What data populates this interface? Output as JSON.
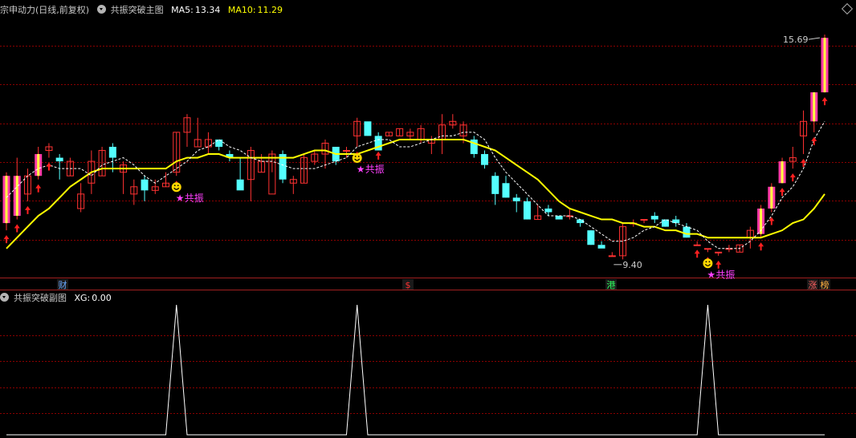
{
  "main_panel": {
    "stock_name": "宗申动力",
    "period_label": "(日线,前复权)",
    "indicator_name": "共振突破主图",
    "ma5_label": "MA5:",
    "ma5_value": "13.34",
    "ma10_label": "MA10:",
    "ma10_value": "11.29",
    "high_label": "15.69",
    "low_label": "9.40",
    "signal_text": "共振",
    "event_markers": [
      "财",
      "$",
      "港",
      "涨",
      "榜"
    ]
  },
  "sub_panel": {
    "indicator_name": "共振突破副图",
    "xg_label": "XG:",
    "xg_value": "0.00"
  },
  "colors": {
    "up": "#ff3232",
    "down": "#54ffff",
    "ma5": "#ffffff",
    "ma10": "#ffff00",
    "grid": "#8b0000",
    "signal": "#ff40ff",
    "arrow": "#ff2020",
    "smiley": "#ffd700"
  },
  "chart_data": [
    {
      "type": "candlestick",
      "title": "",
      "ylim": [
        9.0,
        16.2
      ],
      "candles": [
        [
          10.5,
          11.8,
          10.3,
          11.9
        ],
        [
          10.7,
          11.8,
          10.6,
          12.3
        ],
        [
          11.3,
          11.8,
          11.1,
          12.0
        ],
        [
          11.8,
          12.4,
          11.7,
          12.6
        ],
        [
          12.5,
          12.6,
          12.3,
          12.7
        ],
        [
          12.3,
          12.2,
          11.7,
          12.4
        ],
        [
          11.8,
          12.2,
          11.8,
          12.3
        ],
        [
          10.9,
          11.3,
          10.8,
          11.6
        ],
        [
          11.6,
          12.2,
          11.3,
          12.5
        ],
        [
          11.8,
          12.5,
          11.8,
          12.6
        ],
        [
          12.6,
          12.3,
          11.9,
          12.7
        ],
        [
          11.9,
          12.1,
          11.3,
          12.2
        ],
        [
          11.3,
          11.5,
          11.0,
          11.7
        ],
        [
          11.7,
          11.4,
          11.1,
          11.8
        ],
        [
          11.4,
          11.5,
          11.3,
          11.7
        ],
        [
          11.5,
          11.6,
          11.5,
          11.9
        ],
        [
          11.9,
          13.0,
          11.8,
          13.0
        ],
        [
          13.0,
          13.4,
          12.6,
          13.5
        ],
        [
          12.6,
          12.8,
          12.6,
          13.4
        ],
        [
          12.6,
          12.8,
          12.4,
          13.0
        ],
        [
          12.8,
          12.6,
          12.5,
          12.8
        ],
        [
          12.4,
          12.3,
          12.2,
          12.5
        ],
        [
          11.7,
          11.4,
          11.7,
          12.3
        ],
        [
          11.7,
          12.5,
          11.1,
          12.6
        ],
        [
          11.9,
          12.2,
          11.9,
          12.4
        ],
        [
          11.3,
          12.4,
          11.9,
          12.5
        ],
        [
          12.4,
          11.7,
          11.6,
          12.5
        ],
        [
          11.6,
          11.7,
          11.3,
          11.8
        ],
        [
          11.6,
          12.3,
          11.6,
          12.4
        ],
        [
          12.2,
          12.4,
          12.1,
          12.5
        ],
        [
          12.4,
          12.7,
          12.0,
          12.8
        ],
        [
          12.6,
          12.2,
          12.1,
          12.6
        ],
        [
          12.5,
          12.5,
          12.3,
          12.6
        ],
        [
          12.9,
          13.3,
          12.6,
          13.4
        ],
        [
          13.3,
          12.9,
          12.9,
          13.2
        ],
        [
          12.9,
          12.5,
          12.6,
          13.0
        ],
        [
          12.9,
          13.0,
          12.9,
          13.0
        ],
        [
          12.9,
          13.1,
          12.9,
          13.1
        ],
        [
          12.9,
          13.0,
          12.8,
          13.1
        ],
        [
          12.8,
          13.1,
          12.7,
          13.2
        ],
        [
          12.7,
          12.8,
          12.4,
          12.9
        ],
        [
          12.8,
          13.2,
          12.4,
          13.5
        ],
        [
          13.2,
          13.3,
          13.1,
          13.5
        ],
        [
          12.9,
          13.2,
          12.7,
          13.3
        ],
        [
          12.8,
          12.4,
          12.3,
          12.9
        ],
        [
          12.4,
          12.1,
          12.0,
          12.5
        ],
        [
          11.8,
          11.3,
          11.0,
          11.9
        ],
        [
          11.6,
          11.2,
          11.2,
          11.8
        ],
        [
          11.2,
          11.1,
          10.8,
          11.3
        ],
        [
          11.1,
          10.6,
          10.6,
          11.2
        ],
        [
          10.6,
          10.7,
          10.6,
          11.0
        ],
        [
          10.9,
          10.8,
          10.7,
          11.0
        ],
        [
          10.7,
          10.6,
          10.7,
          10.7
        ],
        [
          10.7,
          10.7,
          10.6,
          10.9
        ],
        [
          10.6,
          10.5,
          10.4,
          10.6
        ],
        [
          10.3,
          9.9,
          9.9,
          10.3
        ],
        [
          9.9,
          9.8,
          9.9,
          10.0
        ],
        [
          9.6,
          9.6,
          9.6,
          9.7
        ],
        [
          9.6,
          10.4,
          9.5,
          10.5
        ],
        [
          10.5,
          10.5,
          10.4,
          10.6
        ],
        [
          10.6,
          10.6,
          10.5,
          10.6
        ],
        [
          10.7,
          10.6,
          10.5,
          10.8
        ],
        [
          10.6,
          10.4,
          10.4,
          10.6
        ],
        [
          10.6,
          10.5,
          10.4,
          10.7
        ],
        [
          10.4,
          10.1,
          10.1,
          10.5
        ],
        [
          9.9,
          9.9,
          9.9,
          10.0
        ],
        [
          9.8,
          9.8,
          9.7,
          9.8
        ],
        [
          9.7,
          9.7,
          9.6,
          9.7
        ],
        [
          9.8,
          9.8,
          9.7,
          9.9
        ],
        [
          9.7,
          9.9,
          9.7,
          9.9
        ],
        [
          10.1,
          10.3,
          9.8,
          10.4
        ],
        [
          10.2,
          10.9,
          10.1,
          11.0
        ],
        [
          10.9,
          11.5,
          10.8,
          11.6
        ],
        [
          11.6,
          12.2,
          11.6,
          12.3
        ],
        [
          12.2,
          12.3,
          12.0,
          12.6
        ],
        [
          12.9,
          13.3,
          12.4,
          13.6
        ],
        [
          13.3,
          14.1,
          13.0,
          14.1
        ],
        [
          14.1,
          15.6,
          14.1,
          15.69
        ]
      ],
      "ma5": [
        11.2,
        11.5,
        11.8,
        12.0,
        12.1,
        12.0,
        12.0,
        12.0,
        11.8,
        12.1,
        12.2,
        12.3,
        12.1,
        11.8,
        11.6,
        11.8,
        12.0,
        12.2,
        12.5,
        12.6,
        12.8,
        12.6,
        12.5,
        12.3,
        12.2,
        12.2,
        12.1,
        12.0,
        12.0,
        12.0,
        12.1,
        12.2,
        12.3,
        12.6,
        12.7,
        12.8,
        12.8,
        12.6,
        12.6,
        12.7,
        12.8,
        12.9,
        12.9,
        13.0,
        13.0,
        12.8,
        12.3,
        11.9,
        11.6,
        11.3,
        11.0,
        10.7,
        10.7,
        10.7,
        10.6,
        10.4,
        10.2,
        10.0,
        10.0,
        10.1,
        10.3,
        10.4,
        10.6,
        10.5,
        10.4,
        10.3,
        10.0,
        9.8,
        9.8,
        9.8,
        10.0,
        10.3,
        10.7,
        11.2,
        11.5,
        12.0,
        12.8,
        13.3
      ],
      "ma10": [
        9.8,
        10.1,
        10.4,
        10.7,
        10.9,
        11.2,
        11.5,
        11.7,
        11.9,
        12.0,
        12.0,
        12.0,
        12.0,
        12.0,
        12.0,
        12.0,
        12.2,
        12.3,
        12.3,
        12.4,
        12.4,
        12.3,
        12.3,
        12.3,
        12.3,
        12.3,
        12.3,
        12.3,
        12.4,
        12.5,
        12.5,
        12.4,
        12.4,
        12.4,
        12.5,
        12.6,
        12.7,
        12.8,
        12.8,
        12.8,
        12.8,
        12.8,
        12.8,
        12.8,
        12.7,
        12.6,
        12.5,
        12.3,
        12.1,
        11.9,
        11.7,
        11.4,
        11.1,
        10.9,
        10.8,
        10.7,
        10.6,
        10.6,
        10.5,
        10.5,
        10.4,
        10.4,
        10.3,
        10.3,
        10.2,
        10.2,
        10.1,
        10.1,
        10.1,
        10.1,
        10.1,
        10.1,
        10.2,
        10.3,
        10.5,
        10.6,
        10.9,
        11.3
      ],
      "signal_indices": [
        16,
        33,
        66
      ],
      "arrow_indices": [
        0,
        1,
        2,
        3,
        4,
        16,
        33,
        35,
        65,
        66,
        67,
        71,
        72,
        73,
        74,
        75,
        76,
        77
      ]
    },
    {
      "type": "line",
      "title": "",
      "ylim": [
        0,
        1
      ],
      "series": [
        {
          "values_by_index": "1 at signal_indices, else 0"
        }
      ]
    }
  ]
}
